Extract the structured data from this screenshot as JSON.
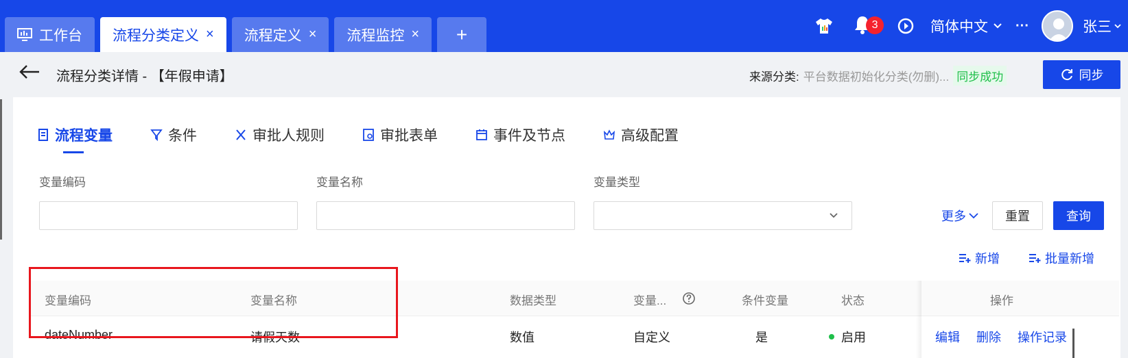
{
  "top_tabs": [
    {
      "label": "工作台"
    },
    {
      "label": "流程分类定义",
      "close": "×"
    },
    {
      "label": "流程定义",
      "close": "×"
    },
    {
      "label": "流程监控",
      "close": "×"
    },
    {
      "label": "+"
    }
  ],
  "top_right": {
    "notification_count": "3",
    "language": "简体中文",
    "more": "···",
    "user_name": "张三"
  },
  "page": {
    "title": "流程分类详情 - 【年假申请】",
    "source_label": "来源分类:",
    "source_value": "平台数据初始化分类(勿删)...",
    "sync_status": "同步成功",
    "sync_button": "同步"
  },
  "sub_tabs": [
    "流程变量",
    "条件",
    "审批人规则",
    "审批表单",
    "事件及节点",
    "高级配置"
  ],
  "filters": {
    "code_label": "变量编码",
    "name_label": "变量名称",
    "type_label": "变量类型",
    "more": "更多",
    "reset": "重置",
    "query": "查询"
  },
  "actions": {
    "add": "新增",
    "batch_add": "批量新增"
  },
  "table": {
    "headers": [
      "变量编码",
      "变量名称",
      "数据类型",
      "变量...",
      "条件变量",
      "状态",
      "操作"
    ],
    "rows": [
      {
        "code": "dateNumber",
        "name": "请假天数",
        "data_type": "数值",
        "var_type": "自定义",
        "condition": "是",
        "status": "启用",
        "op_edit": "编辑",
        "op_delete": "删除",
        "op_log": "操作记录"
      }
    ]
  },
  "colors": {
    "brand": "#1747e8",
    "highlight_box": "#e8161d",
    "status_green": "#1fbf4a",
    "sync_status_bg": "#e6f9ec"
  }
}
